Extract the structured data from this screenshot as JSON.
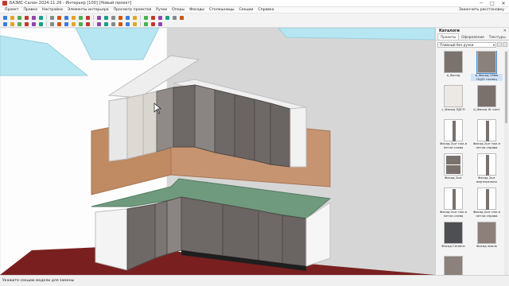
{
  "window": {
    "title": "БАЗИС-Салон 2024.11.26 - Интерьер [100] [Новый проект]",
    "minimize": "─",
    "maximize": "□",
    "close": "✕"
  },
  "menu": {
    "items": [
      "Проект",
      "Правка",
      "Настройки",
      "Элементы интерьера",
      "Просмотр проектов",
      "Ручки",
      "Опоры",
      "Фасады",
      "Столешницы",
      "Секции",
      "Справка"
    ],
    "right_link": "Закончить расстановку"
  },
  "toolbar": {
    "row1_icons": [
      "new-icon",
      "open-icon",
      "save-icon",
      "print-icon",
      "undo-icon",
      "redo-icon",
      "cut-icon",
      "copy-icon",
      "paste-icon",
      "delete-icon",
      "move-icon",
      "rotate-icon",
      "mirror-icon",
      "align-icon",
      "measure-icon",
      "dimension-icon",
      "wall-icon",
      "window-icon",
      "door-icon",
      "floor-icon",
      "light-icon",
      "camera-icon",
      "render-icon",
      "settings-icon"
    ],
    "row2_icons": [
      "select-icon",
      "zoom-in-icon",
      "zoom-out-icon",
      "zoom-fit-icon",
      "pan-icon",
      "orbit-icon",
      "front-view-icon",
      "top-view-icon",
      "side-view-icon",
      "iso-view-icon",
      "wireframe-icon",
      "shaded-icon",
      "texture-icon",
      "grid-icon",
      "snap-icon",
      "layers-icon",
      "lock-icon",
      "eye-icon",
      "color-icon",
      "lamp-icon",
      "info-icon"
    ]
  },
  "panel": {
    "title": "Каталоги",
    "close": "✕",
    "tabs": [
      "Проекты",
      "Оформление",
      "Текстуры"
    ],
    "active_tab": 0,
    "select_value": "Плавный без ручки",
    "items": [
      {
        "label": "a_Фасад",
        "thumb": "plain",
        "color": "#7b726e",
        "selected": false
      },
      {
        "label": "b_Фасад 19мм НЦ20 глянец",
        "thumb": "plain",
        "color": "#8a817c",
        "selected": true
      },
      {
        "label": "c_Фасад ЛДСП",
        "thumb": "plain",
        "color": "#ece8e4",
        "selected": false
      },
      {
        "label": "d_Фасад XL кант",
        "thumb": "plain",
        "color": "#7a716d",
        "selected": false
      },
      {
        "label": "Фасад 2шт пол-е петли слева",
        "thumb": "bar",
        "color": "#7a716d",
        "selected": false
      },
      {
        "label": "Фасад 2шт пол-е петли справа",
        "thumb": "bar",
        "color": "#7a716d",
        "selected": false
      },
      {
        "label": "Фасад 2шт",
        "thumb": "half",
        "color": "#7a716d",
        "selected": false
      },
      {
        "label": "Фасад 2шт вертикально",
        "thumb": "bar",
        "color": "#7a716d",
        "selected": false
      },
      {
        "label": "Фасад 2шт пол-е петли слева",
        "thumb": "bar",
        "color": "#7a716d",
        "selected": false
      },
      {
        "label": "Фасад 2шт пол-е петли справа",
        "thumb": "bar",
        "color": "#7a716d",
        "selected": false
      },
      {
        "label": "Фасад Ceramic",
        "thumb": "plain",
        "color": "#4d4f52",
        "selected": false
      },
      {
        "label": "Фасад эмаль",
        "thumb": "plain",
        "color": "#8d807a",
        "selected": false
      },
      {
        "label": "",
        "thumb": "plain",
        "color": "#8d817c",
        "selected": false
      }
    ]
  },
  "status": {
    "text": "Укажите секцию модели для замены"
  },
  "colors": {
    "floor": "#7a1f1f",
    "wall": "#d8d8d8",
    "cabinet": "#6e6866",
    "backsplash": "#c08a62",
    "countertop": "#6f9a7e"
  }
}
